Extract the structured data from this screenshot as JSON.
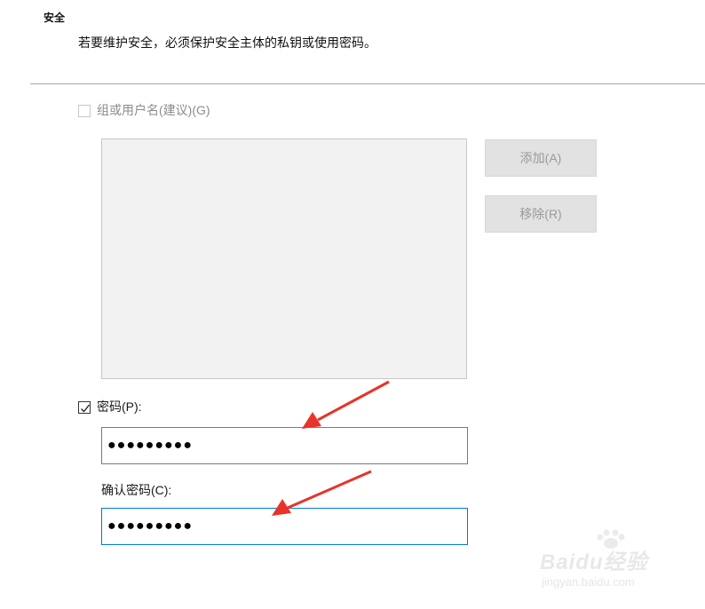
{
  "security": {
    "title": "安全",
    "description": "若要维护安全，必须保护安全主体的私钥或使用密码。"
  },
  "group_option": {
    "label": "组或用户名(建议)(G)",
    "checked": false,
    "enabled": false
  },
  "buttons": {
    "add_label": "添加(A)",
    "remove_label": "移除(R)"
  },
  "password_option": {
    "label": "密码(P):",
    "checked": true
  },
  "password_field": {
    "value": "●●●●●●●●●"
  },
  "confirm_field": {
    "label": "确认密码(C):",
    "value": "●●●●●●●●●"
  },
  "watermark": {
    "brand": "Baidu经验",
    "url": "jingyan.baidu.com"
  },
  "colors": {
    "annotation_arrow": "#e8332a",
    "focus_border": "#0078d7"
  },
  "icons": [
    "checkbox-unchecked-icon",
    "checkbox-checked-icon",
    "red-arrow-annotation-icon",
    "paw-watermark-icon"
  ]
}
